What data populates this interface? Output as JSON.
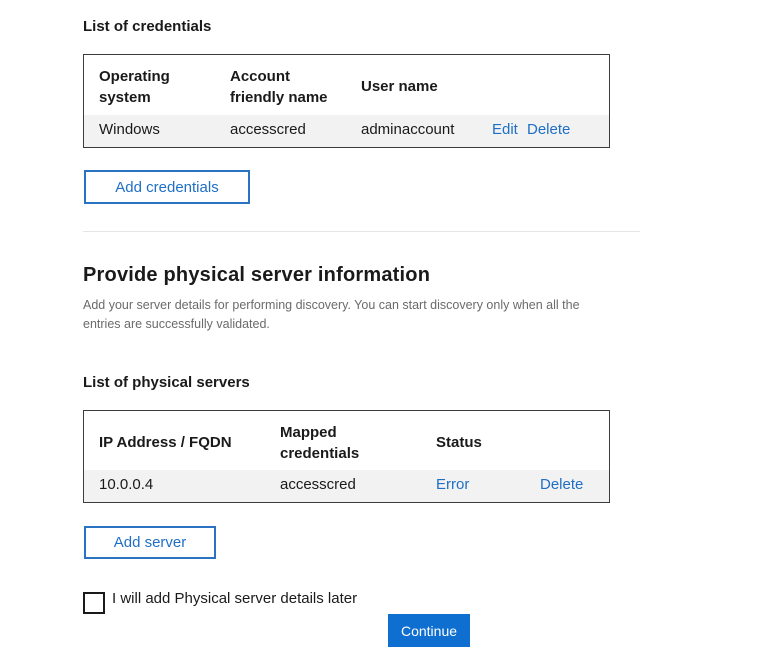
{
  "credentials": {
    "heading": "List of credentials",
    "columns": {
      "os_line1": "Operating",
      "os_line2": "system",
      "friendly_line1": "Account",
      "friendly_line2": "friendly name",
      "username": "User name"
    },
    "rows": [
      {
        "os": "Windows",
        "friendly_name": "accesscred",
        "username": "adminaccount",
        "edit": "Edit",
        "delete": "Delete"
      }
    ],
    "add_button": "Add credentials"
  },
  "physical": {
    "title": "Provide physical server information",
    "description_line1": "Add your server details for performing discovery. You can start discovery only when all the",
    "description_line2": "entries are successfully validated.",
    "heading": "List of physical servers",
    "columns": {
      "ip": "IP Address / FQDN",
      "mapped_line1": "Mapped",
      "mapped_line2": "credentials",
      "status": "Status"
    },
    "rows": [
      {
        "ip": "10.0.0.4",
        "mapped": "accesscred",
        "status": "Error",
        "delete": "Delete"
      }
    ],
    "add_button": "Add server",
    "later_checkbox": {
      "label": "I will add Physical server details later",
      "checked": false
    },
    "continue_button": "Continue"
  },
  "colors": {
    "link": "#1f6fc4",
    "primary": "#0f6fd1",
    "row_bg": "#f2f2f2"
  }
}
